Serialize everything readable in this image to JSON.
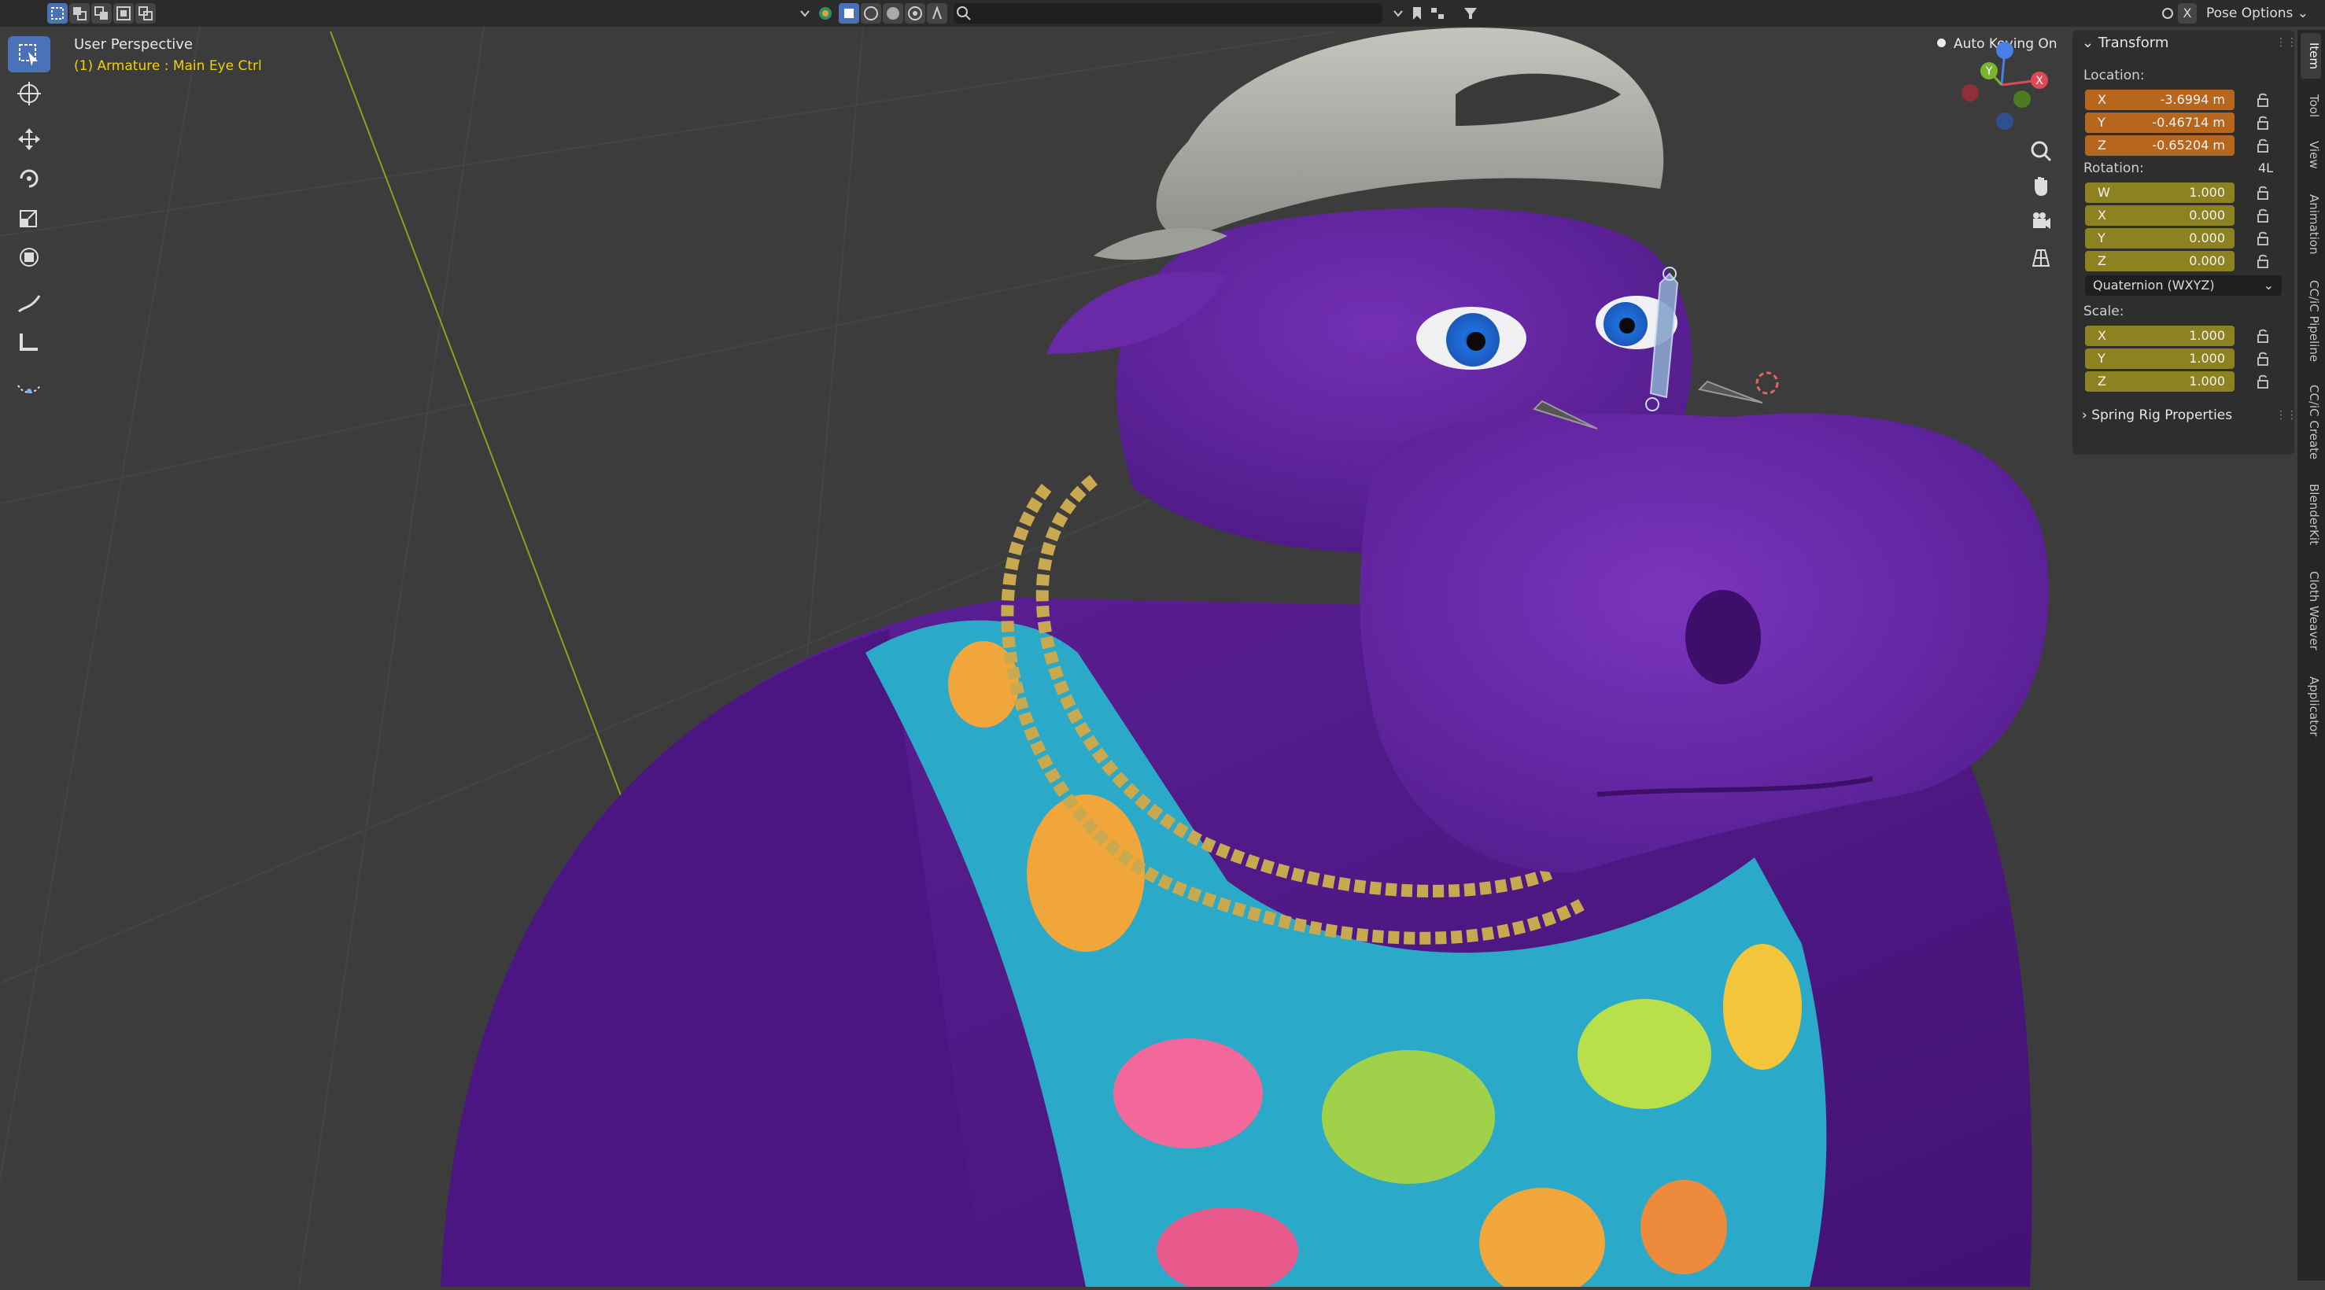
{
  "header": {
    "pose_options": "Pose Options",
    "close_label": "X"
  },
  "viewport": {
    "view_name": "User Perspective",
    "active_object": "(1) Armature : Main Eye Ctrl",
    "auto_keying": "Auto Keying On",
    "colors": {
      "skin": "#5b1f96",
      "shirt": "#2aa9c8",
      "cap": "#b2b4ad",
      "chain": "#c9a94f",
      "eye_iris": "#1f6fe0",
      "grid_line": "#8fa01f"
    }
  },
  "toolbar": {
    "tools": [
      "select-box",
      "cursor",
      "move",
      "rotate",
      "scale",
      "transform",
      "annotate",
      "measure",
      "bone-roll"
    ]
  },
  "npanel": {
    "transform_title": "Transform",
    "location_label": "Location:",
    "location": [
      {
        "axis": "X",
        "value": "-3.6994 m"
      },
      {
        "axis": "Y",
        "value": "-0.46714 m"
      },
      {
        "axis": "Z",
        "value": "-0.65204 m"
      }
    ],
    "rotation_label": "Rotation:",
    "rotation_mode_short": "4L",
    "rotation": [
      {
        "axis": "W",
        "value": "1.000"
      },
      {
        "axis": "X",
        "value": "0.000"
      },
      {
        "axis": "Y",
        "value": "0.000"
      },
      {
        "axis": "Z",
        "value": "0.000"
      }
    ],
    "rotation_mode": "Quaternion (WXYZ)",
    "scale_label": "Scale:",
    "scale": [
      {
        "axis": "X",
        "value": "1.000"
      },
      {
        "axis": "Y",
        "value": "1.000"
      },
      {
        "axis": "Z",
        "value": "1.000"
      }
    ],
    "spring_rig_title": "Spring Rig Properties"
  },
  "side_tabs": [
    "Item",
    "Tool",
    "View",
    "Animation",
    "CC/iC Pipeline",
    "CC/iC Create",
    "BlenderKit",
    "Cloth Weaver",
    "Applicator"
  ]
}
